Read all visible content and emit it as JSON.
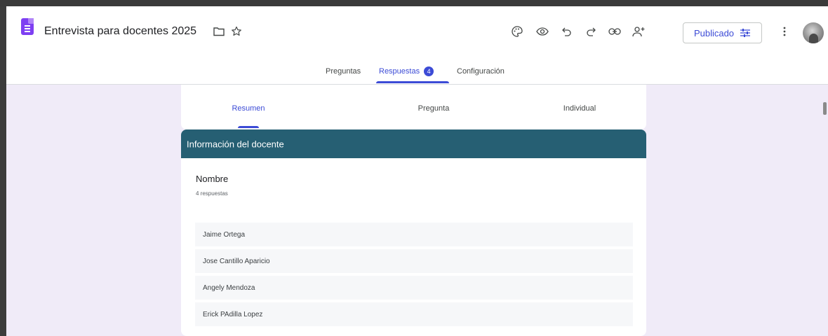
{
  "header": {
    "title": "Entrevista para docentes 2025",
    "publish_label": "Publicado"
  },
  "tabs": [
    {
      "label": "Preguntas"
    },
    {
      "label": "Respuestas",
      "badge": "4"
    },
    {
      "label": "Configuración"
    }
  ],
  "subtabs": [
    {
      "label": "Resumen"
    },
    {
      "label": "Pregunta"
    },
    {
      "label": "Individual"
    }
  ],
  "section": {
    "title": "Información del docente"
  },
  "question": {
    "title": "Nombre",
    "count": "4 respuestas",
    "answers": [
      "Jaime Ortega",
      "Jose Cantillo Aparicio",
      "Angely Mendoza",
      "Erick PAdilla Lopez"
    ]
  },
  "colors": {
    "accent": "#3c4bd6",
    "section_header": "#265f73",
    "page_background": "#f0ebf8",
    "forms_logo": "#7e3ff2"
  },
  "icons": [
    "folder-icon",
    "star-icon",
    "palette-icon",
    "eye-icon",
    "undo-icon",
    "redo-icon",
    "link-icon",
    "add-person-icon",
    "sliders-icon",
    "more-vert-icon"
  ]
}
